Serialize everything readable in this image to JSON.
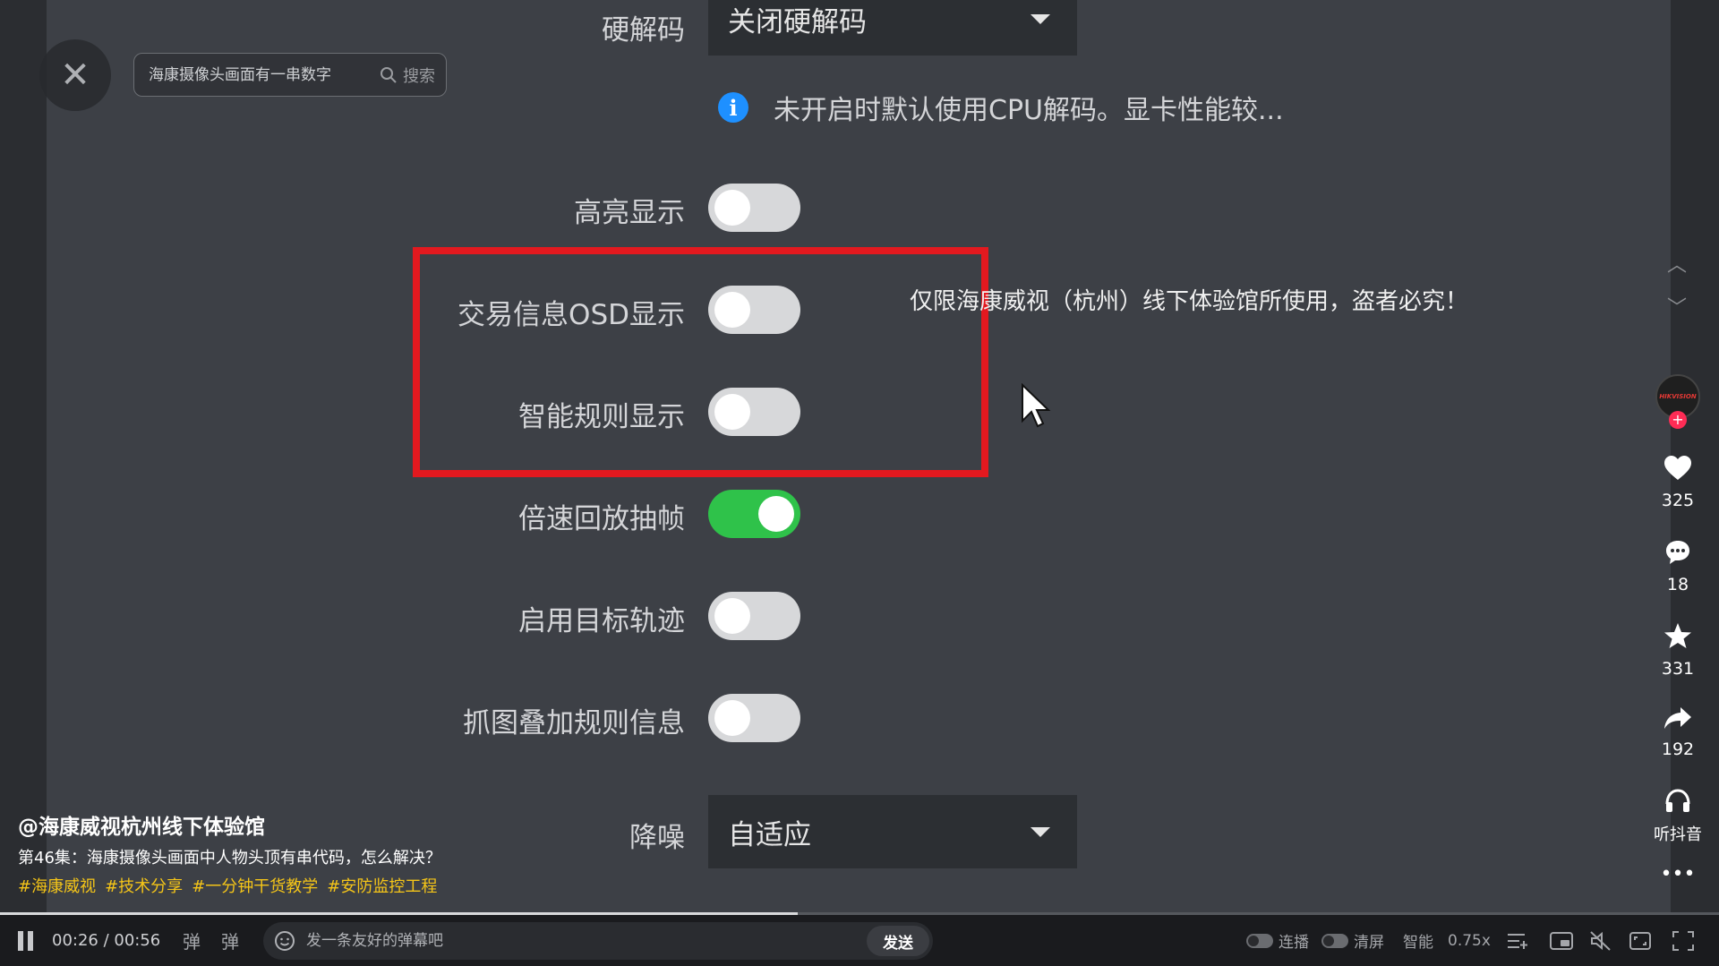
{
  "search": {
    "placeholder": "海康摄像头画面有一串数字",
    "button_label": "搜索"
  },
  "settings": {
    "hard_decode": {
      "label": "硬解码",
      "value": "关闭硬解码"
    },
    "info_text": "未开启时默认使用CPU解码。显卡性能较...",
    "toggles": [
      {
        "label": "高亮显示",
        "on": false
      },
      {
        "label": "交易信息OSD显示",
        "on": false
      },
      {
        "label": "智能规则显示",
        "on": false
      },
      {
        "label": "倍速回放抽帧",
        "on": true
      },
      {
        "label": "启用目标轨迹",
        "on": false
      },
      {
        "label": "抓图叠加规则信息",
        "on": false
      }
    ],
    "noise": {
      "label": "降噪",
      "value": "自适应"
    }
  },
  "watermark": "仅限海康威视（杭州）线下体验馆所使用，盗者必究！",
  "side": {
    "avatar_text": "HIKVISION",
    "likes": "325",
    "comments": "18",
    "favorites": "331",
    "shares": "192",
    "listen_label": "听抖音"
  },
  "video": {
    "author": "@海康威视杭州线下体验馆",
    "description": "第46集：海康摄像头画面中人物头顶有串代码，怎么解决？",
    "tags": [
      "#海康威视",
      "#技术分享",
      "#一分钟干货教学",
      "#安防监控工程"
    ]
  },
  "player": {
    "time": "00:26 / 00:56",
    "progress": 0.464,
    "danmu_icon_1": "弹",
    "danmu_icon_2": "弹",
    "danmu_placeholder": "发一条友好的弹幕吧",
    "send_label": "发送",
    "autoplay_label": "连播",
    "clear_label": "清屏",
    "quality_label": "智能",
    "speed_label": "0.75x"
  },
  "colors": {
    "accent_green": "#2fc24a",
    "highlight_red": "#e3191f",
    "tag_yellow": "#f5c518",
    "info_blue": "#1e90ff"
  }
}
